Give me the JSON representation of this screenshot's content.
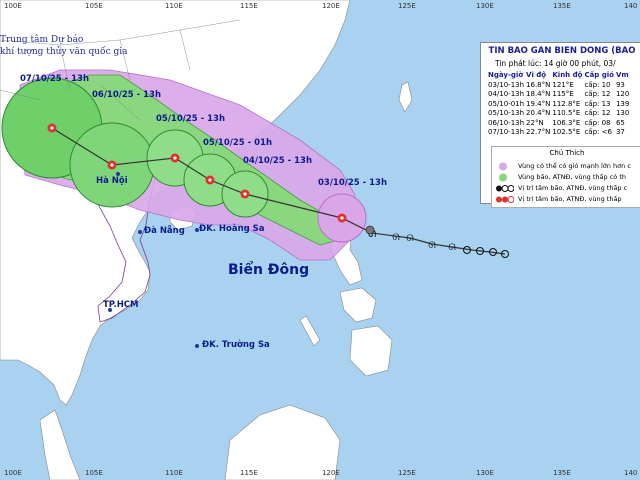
{
  "map": {
    "agency_line1": "Trung tâm Dự báo",
    "agency_line2": "khí tượng thủy văn quốc gia",
    "top_axis": [
      "100E",
      "105E",
      "110E",
      "115E",
      "120E",
      "125E",
      "130E",
      "135E",
      "140"
    ],
    "bottom_axis": [
      "100E",
      "105E",
      "110E",
      "115E",
      "120E",
      "125E",
      "130E",
      "135E",
      "140"
    ],
    "colors": {
      "sea": "#a8d2f0",
      "land": "#ffffff",
      "purple_zone": "#d9a6e8",
      "green_zone": "#86d97a",
      "track": "#333333",
      "storm_red": "#e03030"
    },
    "places": {
      "hanoi": "Hà Nội",
      "danang": "Đà Nẵng",
      "hoangsa": "ĐK. Hoàng Sa",
      "hcm": "TP.HCM",
      "truongsa": "ĐK. Trường Sa",
      "biendong": "Biển Đông"
    },
    "forecast_labels": [
      {
        "id": "f0710",
        "text": "07/10/25 - 13h"
      },
      {
        "id": "f0610",
        "text": "06/10/25 - 13h"
      },
      {
        "id": "f0510a",
        "text": "05/10/25 - 13h"
      },
      {
        "id": "f0510b",
        "text": "05/10/25 - 01h"
      },
      {
        "id": "f0410",
        "text": "04/10/25 - 13h"
      },
      {
        "id": "f0310",
        "text": "03/10/25 - 13h"
      }
    ]
  },
  "panel": {
    "title": "TIN BAO GAN BIEN DONG (BAO",
    "subtitle": "Tin phát lúc: 14 giờ 00 phút, 03/",
    "headers": [
      "Ngày-giờ",
      "Vĩ độ",
      "Kinh độ",
      "Cấp gió",
      "Vm"
    ],
    "rows": [
      [
        "03/10-13h",
        "16.8°N",
        "121°E",
        "cấp: 10",
        "93"
      ],
      [
        "04/10-13h",
        "18.4°N",
        "115°E",
        "cấp: 12",
        "120"
      ],
      [
        "05/10-01h",
        "19.4°N",
        "112.8°E",
        "cấp: 13",
        "139"
      ],
      [
        "05/10-13h",
        "20.4°N",
        "110.5°E",
        "cấp: 12",
        "130"
      ],
      [
        "06/10-13h",
        "22°N",
        "106.3°E",
        "cấp: 08",
        "65"
      ],
      [
        "07/10-13h",
        "22.7°N",
        "102.5°E",
        "cấp: <6",
        "37"
      ]
    ]
  },
  "legend": {
    "title": "Chú Thích",
    "items": [
      "Vùng có thể có gió mạnh lớn hơn c",
      "Vùng bão, ATNĐ, vùng thấp có th",
      "Vị trí tâm bão, ATNĐ, vùng thấp c",
      "Vị trí tâm bão, ATNĐ, vùng thấp"
    ]
  }
}
